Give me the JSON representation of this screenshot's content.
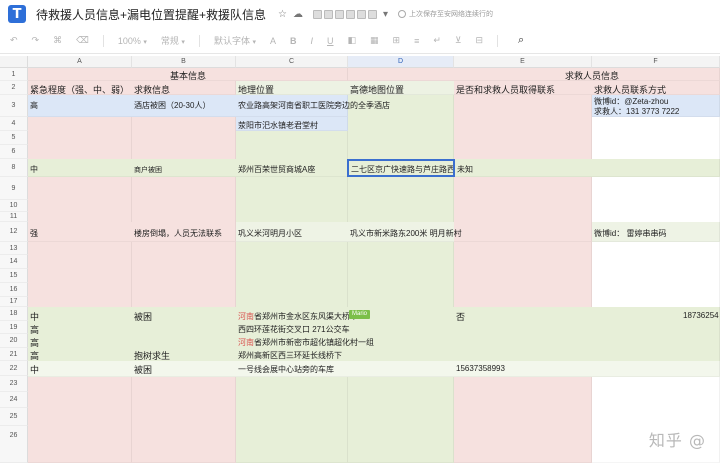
{
  "title_bar": {
    "app_icon_letter": "T",
    "doc_title": "待救援人员信息+漏电位置提醒+救援队信息",
    "icons": [
      "star-icon",
      "cloud-icon"
    ],
    "save_status": "上次保存至安网络连续行的"
  },
  "toolbar": {
    "tools": [
      "undo-icon",
      "redo-icon",
      "format-painter-icon",
      "clear-format-icon"
    ],
    "zoom_label": "100%",
    "style_label": "常规",
    "font_label": "默认字体",
    "search_icon": "search-icon"
  },
  "columns": [
    "A",
    "B",
    "C",
    "D",
    "E",
    "F"
  ],
  "rows": [
    "1",
    "2",
    "3",
    "4",
    "5",
    "6",
    "8",
    "9",
    "10",
    "11",
    "12",
    "13",
    "14",
    "15",
    "16",
    "17",
    "18",
    "19",
    "20",
    "21",
    "22",
    "23",
    "24",
    "25",
    "26"
  ],
  "cells": {
    "r1_basic": "基本信息",
    "r1_rescuer": "求救人员信息",
    "r2_a": "紧急程度（强、中、弱）",
    "r2_b": "求救信息",
    "r2_c": "地理位置",
    "r2_d": "高德地图位置",
    "r2_e": "是否和求救人员取得联系",
    "r2_f": "求救人员联系方式",
    "r3_a": "高",
    "r3_b": "酒店被困（20-30人）",
    "r3_c": "农业路高架河南省职工医院旁边的全季酒店",
    "r3_f1": "微博id：@Zeta-zhou",
    "r3_f2": "求救人：131 3773 7222",
    "r4_c": "荥阳市汜水镇老君堂村",
    "r8_a": "中",
    "r8_b": "商户被困",
    "r8_c": "郑州百荣世贸商城A座",
    "r8_d": "二七区京广快速路与芦庄路西南",
    "r8_e": "未知",
    "r12_a": "强",
    "r12_b": "楼房倒塌，人员无法联系",
    "r12_c": "巩义米河明月小区",
    "r12_d": "巩义市新米路东200米 明月新村",
    "r12_f": "微博id： 雷婷串串码",
    "r18_a": "中",
    "r18_b": "被困",
    "r18_c_red": "河南",
    "r18_c": "省郑州市金水区东风渠大桥下",
    "r18_e": "否",
    "r18_f": "18736254",
    "r19_a": "高",
    "r19_c": "西四环莲花街交叉口 271公交车",
    "r20_a": "高",
    "r20_c_red": "河南",
    "r20_c": "省郑州市新密市超化镇超化村一组",
    "r21_a": "高",
    "r21_b": "抱树求生",
    "r21_c": "郑州高新区西三环延长线桥下",
    "r22_a": "中",
    "r22_b": "被困",
    "r22_c": "一号线会展中心站旁的车库",
    "r22_e": "15637358993"
  },
  "user_marker": "Mario",
  "watermark": "知乎 @"
}
